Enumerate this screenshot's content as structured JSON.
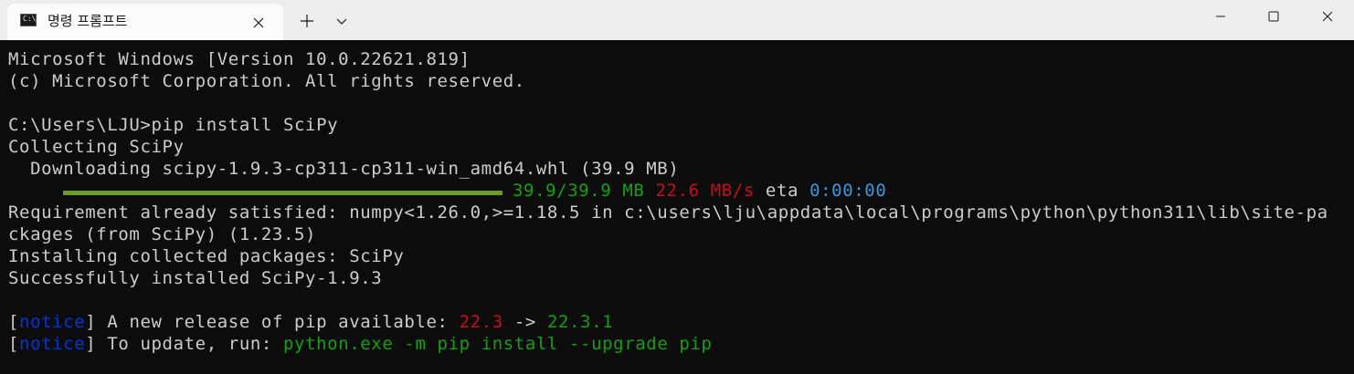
{
  "window": {
    "tab_title": "명령 프롬프트",
    "tab_icon": "terminal-icon",
    "new_tab_icon": "plus-icon",
    "dropdown_icon": "chevron-down-icon",
    "minimize_icon": "minimize-icon",
    "maximize_icon": "maximize-icon",
    "close_icon": "close-icon"
  },
  "terminal": {
    "line1": "Microsoft Windows [Version 10.0.22621.819]",
    "line2": "(c) Microsoft Corporation. All rights reserved.",
    "line3": "C:\\Users\\LJU>pip install SciPy",
    "line4": "Collecting SciPy",
    "line5": "  Downloading scipy-1.9.3-cp311-cp311-win_amd64.whl (39.9 MB)",
    "progress": {
      "fraction": 1.0,
      "size": "39.9/39.9 MB",
      "speed": "22.6 MB/s",
      "eta_label": "eta",
      "eta": "0:00:00"
    },
    "line7": "Requirement already satisfied: numpy<1.26.0,>=1.18.5 in c:\\users\\lju\\appdata\\local\\programs\\python\\python311\\lib\\site-pa",
    "line8": "ckages (from SciPy) (1.23.5)",
    "line9": "Installing collected packages: SciPy",
    "line10": "Successfully installed SciPy-1.9.3",
    "notice1": {
      "open": "[",
      "tag": "notice",
      "close": "]",
      "text": " A new release of pip available: ",
      "old_version": "22.3",
      "arrow": " -> ",
      "new_version": "22.3.1"
    },
    "notice2": {
      "open": "[",
      "tag": "notice",
      "close": "]",
      "text": " To update, run: ",
      "command": "python.exe -m pip install --upgrade pip"
    }
  },
  "colors": {
    "background": "#0c0c0c",
    "foreground": "#cccccc",
    "green": "#13a10e",
    "red": "#c50f1f",
    "blue": "#3a96dd",
    "navy": "#0037da",
    "progress_bar": "#6a9a23"
  }
}
